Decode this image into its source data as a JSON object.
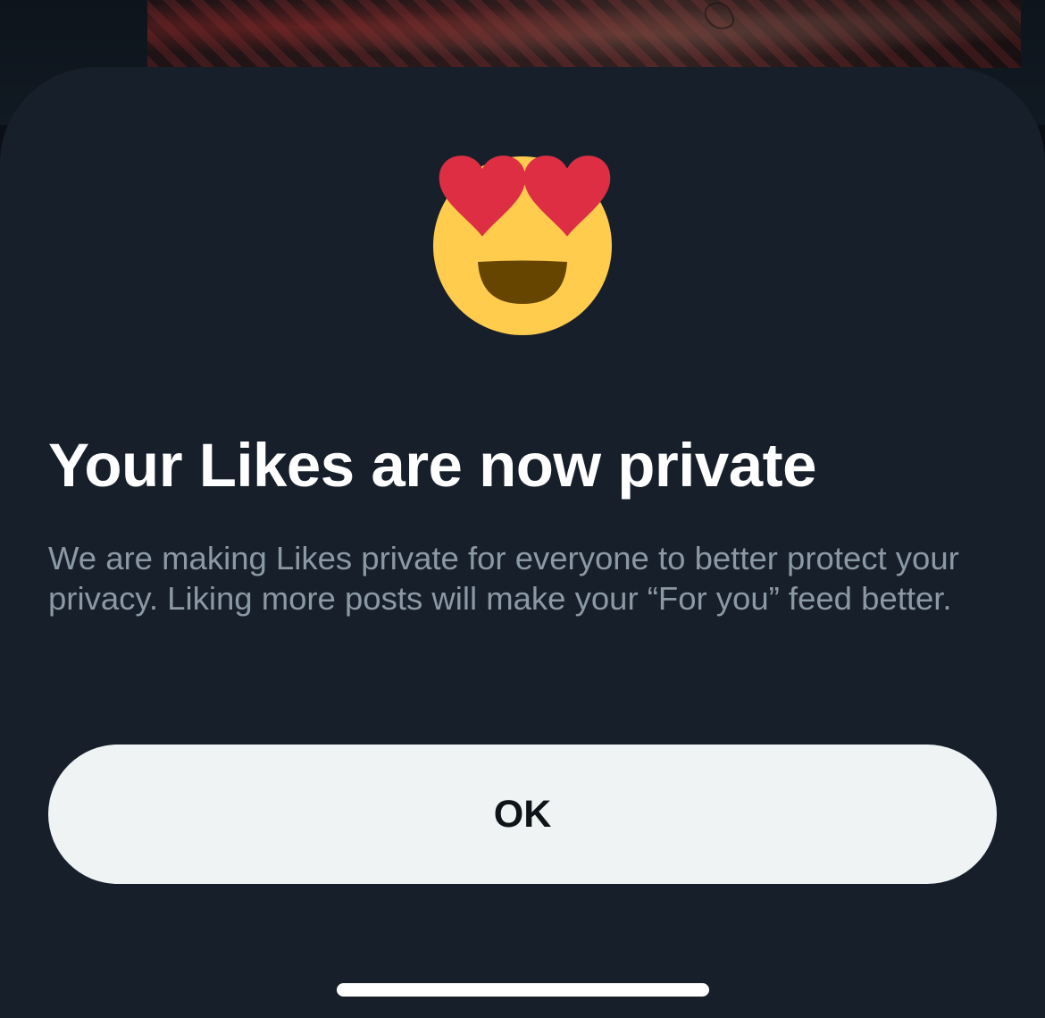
{
  "dialog": {
    "icon": "smiling-face-with-heart-eyes-icon",
    "title": "Your Likes are now private",
    "body": "We are making Likes private for everyone to better protect your privacy. Liking more posts will make your “For you” feed better.",
    "ok_label": "OK"
  },
  "colors": {
    "sheet_background": "#17202a",
    "title_text": "#ffffff",
    "body_text": "#8b98a5",
    "button_background": "#eff3f4",
    "button_text": "#0f1419",
    "emoji_face": "#ffcc4d",
    "emoji_hearts": "#dd2e44",
    "emoji_mouth": "#664500"
  }
}
